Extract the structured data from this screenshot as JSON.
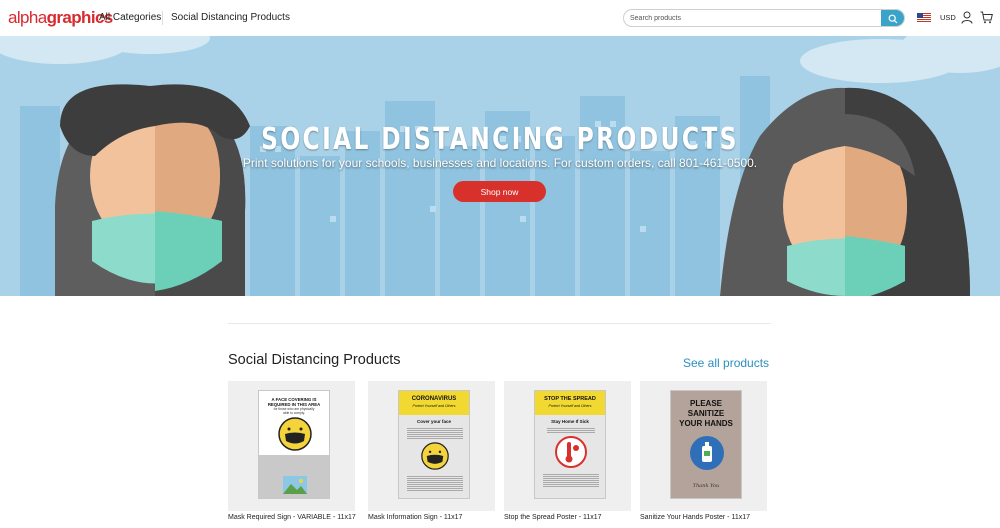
{
  "header": {
    "logo_alpha": "alpha",
    "logo_graphics": "graphics",
    "nav_all_categories": "All Categories",
    "nav_current": "Social Distancing Products",
    "search_placeholder": "Search products",
    "currency": "USD",
    "icons": {
      "search": "search-icon",
      "flag": "us-flag-icon",
      "user": "user-icon",
      "cart": "cart-icon"
    },
    "colors": {
      "brand_red": "#d82a2f",
      "search_button": "#3aa3c9"
    }
  },
  "hero": {
    "title": "SOCIAL DISTANCING PRODUCTS",
    "subtitle": "Print solutions for your schools, businesses and locations. For custom orders, call 801-461-0500.",
    "cta_label": "Shop now",
    "colors": {
      "background": "#a9d2e8",
      "cta": "#d8312c"
    }
  },
  "products_section": {
    "title": "Social Distancing Products",
    "see_all_label": "See all products",
    "items": [
      {
        "name": "Mask Required Sign - VARIABLE - 11x17",
        "poster": {
          "line1": "A FACE COVERING IS",
          "line2": "REQUIRED IN THIS AREA",
          "line3": "for those who are physically",
          "line4": "able to comply."
        }
      },
      {
        "name": "Mask Information Sign - 11x17",
        "poster": {
          "line1": "CORONAVIRUS",
          "line2": "Protect Yourself and Others",
          "line3": "Cover your face"
        }
      },
      {
        "name": "Stop the Spread Poster - 11x17",
        "poster": {
          "line1": "STOP THE SPREAD",
          "line2": "Protect Yourself and Others",
          "line3": "Stay Home If Sick"
        }
      },
      {
        "name": "Sanitize Your Hands Poster - 11x17",
        "poster": {
          "line1": "PLEASE",
          "line2": "SANITIZE",
          "line3": "YOUR HANDS",
          "line4": "Thank You"
        }
      }
    ]
  }
}
